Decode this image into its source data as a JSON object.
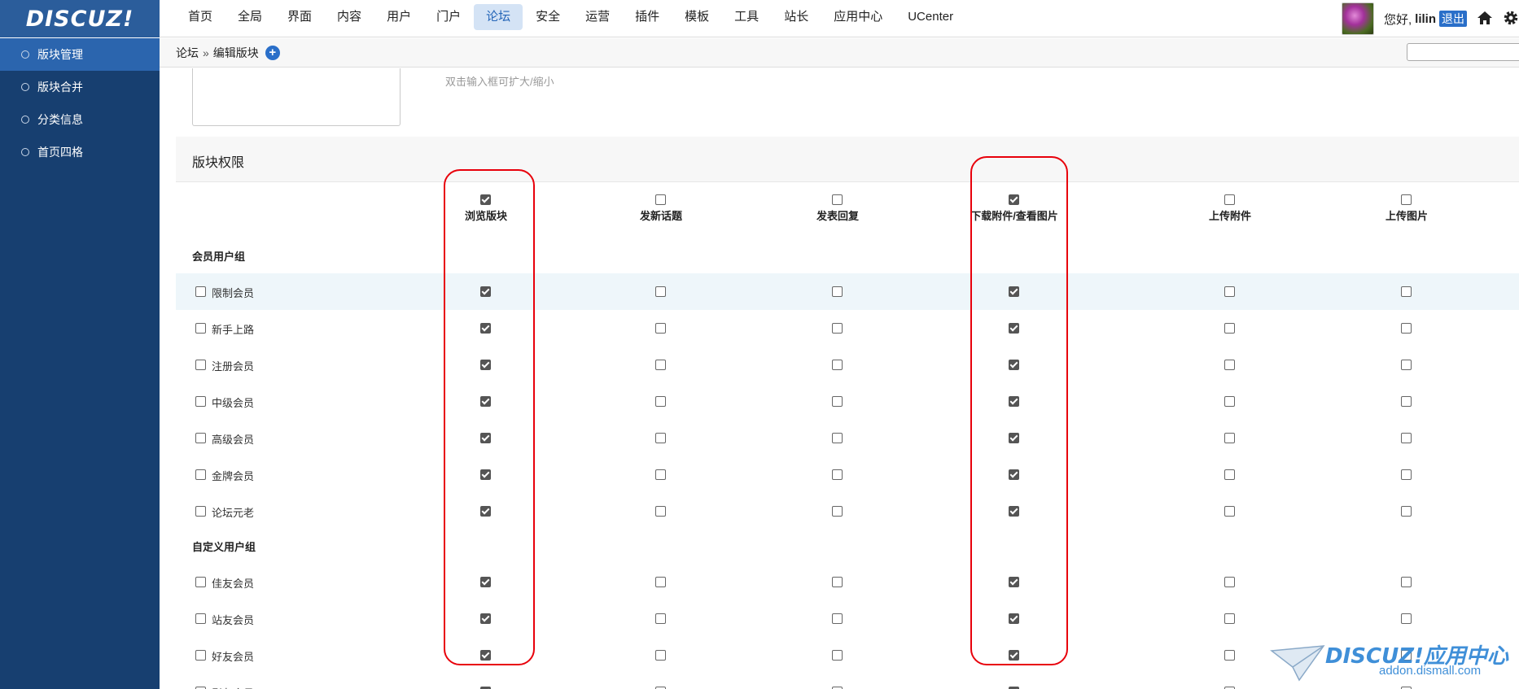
{
  "logo": "DISCUZ!",
  "topnav": [
    "首页",
    "全局",
    "界面",
    "内容",
    "用户",
    "门户",
    "论坛",
    "安全",
    "运营",
    "插件",
    "模板",
    "工具",
    "站长",
    "应用中心",
    "UCenter"
  ],
  "topnav_active": "论坛",
  "user": {
    "greeting": "您好,",
    "name": "lilin",
    "logout": "退出"
  },
  "breadcrumb": {
    "parent": "论坛",
    "sep": "»",
    "current": "编辑版块"
  },
  "sidebar": [
    "版块管理",
    "版块合并",
    "分类信息",
    "首页四格"
  ],
  "sidebar_active": "版块管理",
  "hint": "双击输入框可扩大/缩小",
  "section_title": "版块权限",
  "columns": [
    {
      "label": "浏览版块",
      "header_checked": true
    },
    {
      "label": "发新话题",
      "header_checked": false
    },
    {
      "label": "发表回复",
      "header_checked": false
    },
    {
      "label": "下载附件/查看图片",
      "header_checked": true
    },
    {
      "label": "上传附件",
      "header_checked": false
    },
    {
      "label": "上传图片",
      "header_checked": false
    }
  ],
  "groups": [
    {
      "label": "会员用户组",
      "rows": [
        {
          "label": "限制会员",
          "checks": [
            true,
            false,
            false,
            true,
            false,
            false
          ]
        },
        {
          "label": "新手上路",
          "checks": [
            true,
            false,
            false,
            true,
            false,
            false
          ]
        },
        {
          "label": "注册会员",
          "checks": [
            true,
            false,
            false,
            true,
            false,
            false
          ]
        },
        {
          "label": "中级会员",
          "checks": [
            true,
            false,
            false,
            true,
            false,
            false
          ]
        },
        {
          "label": "高级会员",
          "checks": [
            true,
            false,
            false,
            true,
            false,
            false
          ]
        },
        {
          "label": "金牌会员",
          "checks": [
            true,
            false,
            false,
            true,
            false,
            false
          ]
        },
        {
          "label": "论坛元老",
          "checks": [
            true,
            false,
            false,
            true,
            false,
            false
          ]
        }
      ]
    },
    {
      "label": "自定义用户组",
      "rows": [
        {
          "label": "佳友会员",
          "checks": [
            true,
            false,
            false,
            true,
            false,
            false
          ]
        },
        {
          "label": "站友会员",
          "checks": [
            true,
            false,
            false,
            true,
            false,
            false
          ]
        },
        {
          "label": "好友会员",
          "checks": [
            true,
            false,
            false,
            true,
            false,
            false
          ]
        },
        {
          "label": "影友会员",
          "checks": [
            true,
            false,
            false,
            true,
            false,
            false
          ]
        }
      ]
    }
  ],
  "watermark": {
    "title": "DISCUZ!应用中心",
    "url": "addon.dismall.com"
  },
  "colors": {
    "sidebar": "#173f70",
    "sidebar_active": "#2b65ae",
    "logo_bg": "#2b5d9b",
    "highlight_oval": "#e8000b",
    "accent": "#2a6fc9"
  }
}
